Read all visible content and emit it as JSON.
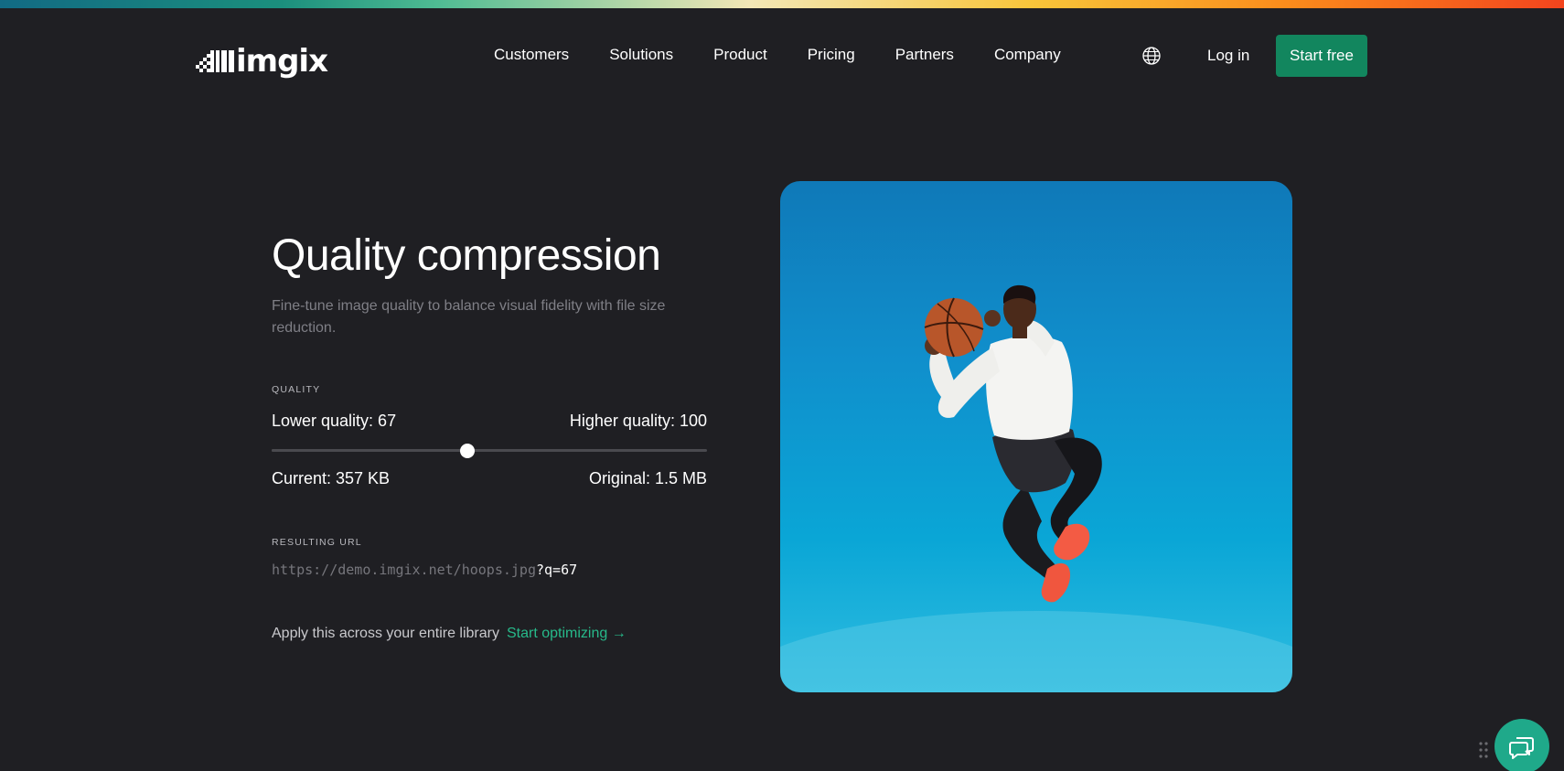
{
  "header": {
    "logo_text": "imgix",
    "nav": [
      "Customers",
      "Solutions",
      "Product",
      "Pricing",
      "Partners",
      "Company"
    ],
    "login_label": "Log in",
    "cta_label": "Start free"
  },
  "main": {
    "title": "Quality compression",
    "subtitle": "Fine-tune image quality to balance visual fidelity with file size reduction.",
    "quality_label": "QUALITY",
    "lower_quality": "Lower quality: 67",
    "higher_quality": "Higher quality: 100",
    "slider": {
      "min": 0,
      "max": 100,
      "value": 45
    },
    "current_size": "Current: 357 KB",
    "original_size": "Original: 1.5 MB",
    "url_label": "RESULTING URL",
    "url_base": "https://demo.imgix.net/hoops.jpg",
    "url_param": "?q=67",
    "apply_text": "Apply this across your entire library",
    "apply_link": "Start optimizing →"
  },
  "icons": {
    "globe": "globe-icon",
    "chat": "chat-icon",
    "drag": "drag-handle-icon"
  },
  "colors": {
    "background": "#1f1f23",
    "accent_green": "#12865e",
    "link_green": "#27b98a",
    "sky_blue": "#108fcc"
  }
}
